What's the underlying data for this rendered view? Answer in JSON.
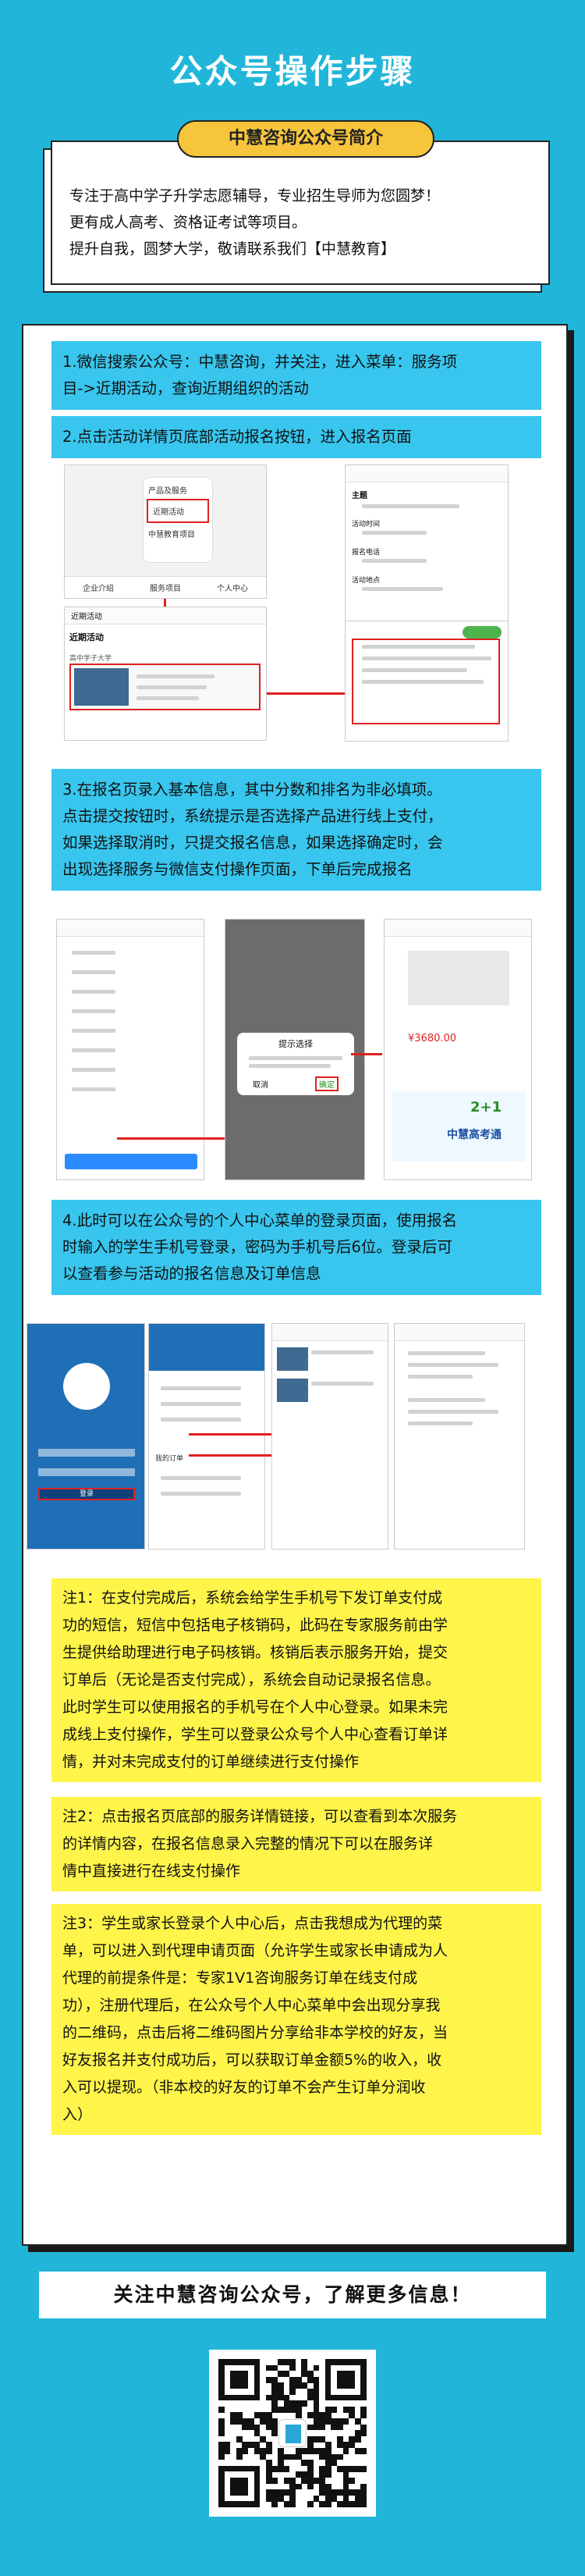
{
  "page": {
    "title": "公众号操作步骤"
  },
  "intro": {
    "badge": "中慧咨询公众号简介",
    "lines": [
      "专注于高中学子升学志愿辅导，专业招生导师为您圆梦！",
      "更有成人高考、资格证考试等项目。",
      "提升自我，圆梦大学，敬请联系我们【中慧教育】"
    ]
  },
  "steps": [
    {
      "lines": [
        "1.微信搜索公众号：中慧咨询，并关注，进入菜单：服务项",
        "目->近期活动，查询近期组织的活动"
      ]
    },
    {
      "lines": [
        "2.点击活动详情页底部活动报名按钮，进入报名页面"
      ]
    },
    {
      "lines": [
        "3.在报名页录入基本信息，其中分数和排名为非必填项。",
        "点击提交按钮时，系统提示是否选择产品进行线上支付，",
        "如果选择取消时，只提交报名信息，如果选择确定时，会",
        "出现选择服务与微信支付操作页面，下单后完成报名"
      ]
    },
    {
      "lines": [
        "4.此时可以在公众号的个人中心菜单的登录页面，使用报名",
        "时输入的学生手机号登录，密码为手机号后6位。登录后可",
        "以查看参与活动的报名信息及订单信息"
      ]
    }
  ],
  "screens": {
    "s1_menu": [
      "产品及服务",
      "近期活动",
      "中慧教育项目"
    ],
    "s1_tabs": [
      "企业介绍",
      "服务项目",
      "个人中心"
    ],
    "s1_list_title": "近期活动",
    "s1_list_title2": "近期活动",
    "s1_item": "高中学子大学",
    "s1_detail_title": "主题",
    "s1_detail_fields": [
      "活动时间",
      "报名电话",
      "活动地点"
    ],
    "s3_dialog_title": "提示选择",
    "s3_dialog_cancel": "取消",
    "s3_dialog_ok": "确定",
    "s3_price": "¥3680.00",
    "s3_banner": "中慧高考通",
    "s3_banner_tag": "2+1",
    "s4_login_btn": "登录",
    "s4_menu_item": "我的订单"
  },
  "notes": [
    {
      "lines": [
        "注1：在支付完成后，系统会给学生手机号下发订单支付成",
        "功的短信，短信中包括电子核销码，此码在专家服务前由学",
        "生提供给助理进行电子码核销。核销后表示服务开始，提交",
        "订单后（无论是否支付完成），系统会自动记录报名信息。",
        "此时学生可以使用报名的手机号在个人中心登录。如果未完",
        "成线上支付操作，学生可以登录公众号个人中心查看订单详",
        "情，并对未完成支付的订单继续进行支付操作"
      ]
    },
    {
      "lines": [
        "注2：点击报名页底部的服务详情链接，可以查看到本次服务",
        "的详情内容，在报名信息录入完整的情况下可以在服务详",
        "情中直接进行在线支付操作"
      ]
    },
    {
      "lines": [
        "注3：学生或家长登录个人中心后，点击我想成为代理的菜",
        "单，可以进入到代理申请页面（允许学生或家长申请成为人",
        "代理的前提条件是：专家1V1咨询服务订单在线支付成",
        "功），注册代理后，在公众号个人中心菜单中会出现分享我",
        "的二维码，点击后将二维码图片分享给非本学校的好友，当",
        "好友报名并支付成功后，可以获取订单金额5%的收入，收",
        "入可以提现。（非本校的好友的订单不会产生订单分润收",
        "入）"
      ]
    }
  ],
  "footer": {
    "slogan": "关注中慧咨询公众号，了解更多信息！"
  },
  "colors": {
    "background": "#21b6d9",
    "step_band": "#38c6ee",
    "note_band": "#fff44a",
    "badge": "#f6c53b",
    "accent_red": "#e02020"
  }
}
